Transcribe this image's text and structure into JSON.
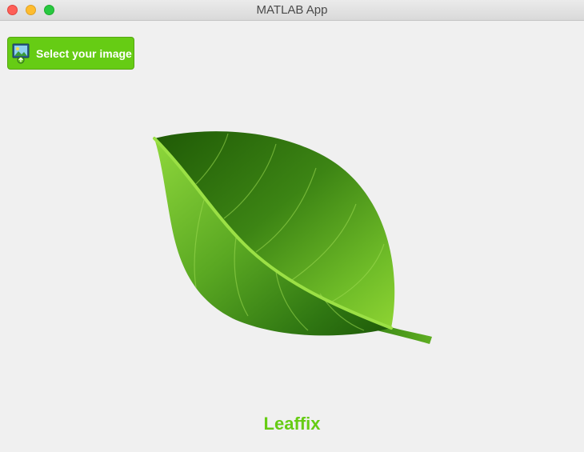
{
  "window": {
    "title": "MATLAB App"
  },
  "toolbar": {
    "select_image_label": "Select your image",
    "select_image_icon": "image-upload-icon"
  },
  "main": {
    "illustration": "leaf-icon",
    "app_name": "Leaffix"
  },
  "colors": {
    "accent": "#66cc14",
    "accent_border": "#55a612",
    "background": "#f0f0f0"
  }
}
